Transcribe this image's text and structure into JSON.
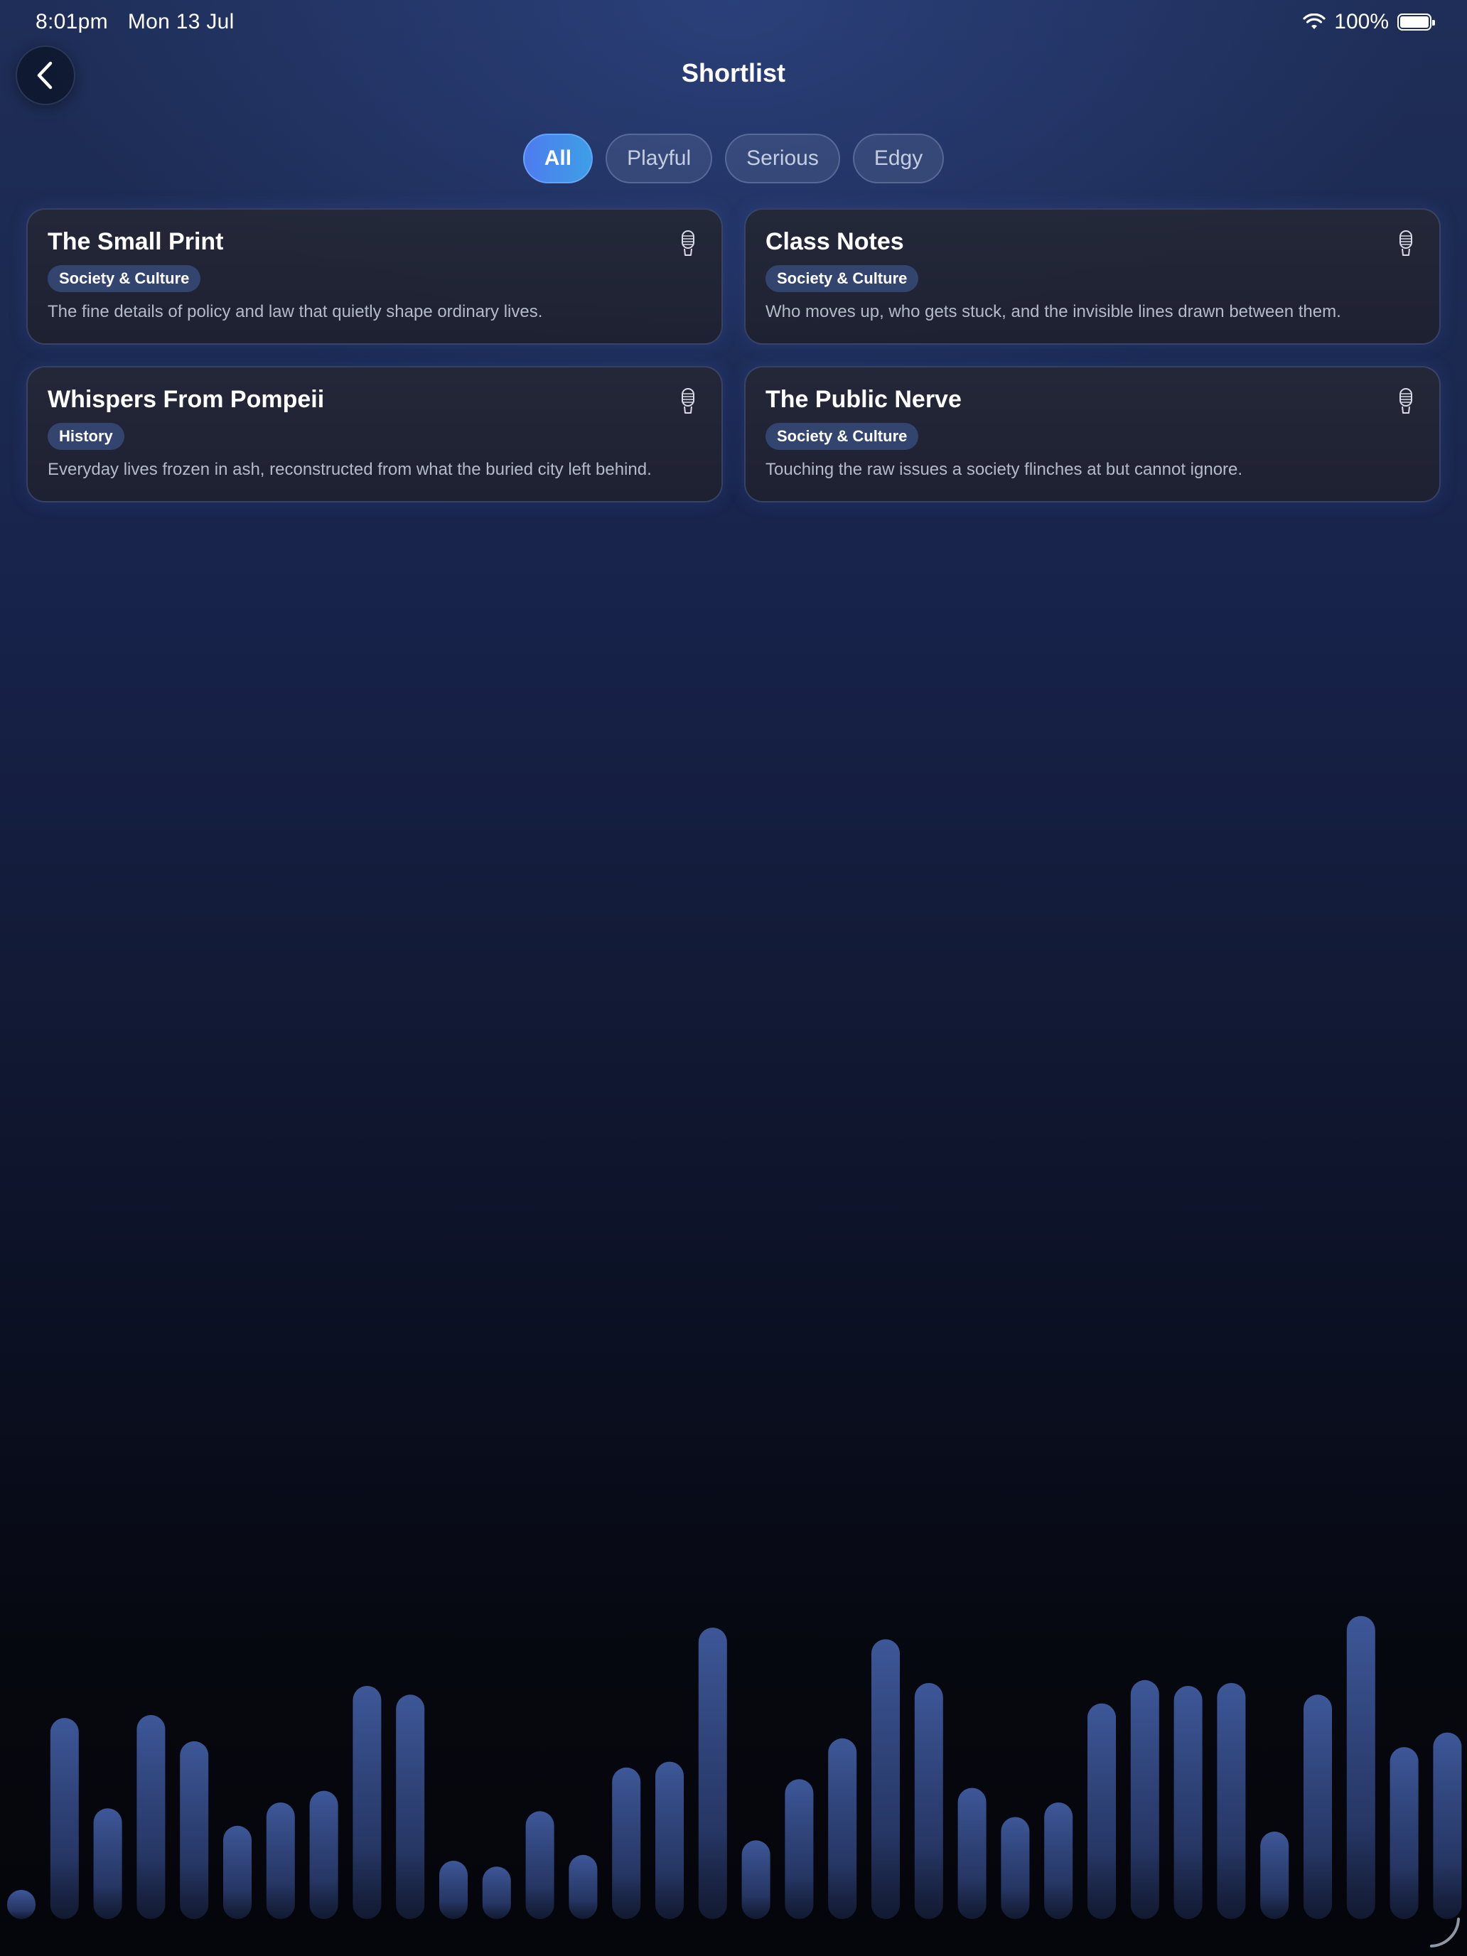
{
  "status_bar": {
    "time": "8:01pm",
    "date": "Mon 13 Jul",
    "battery_text": "100%",
    "battery_level": 1.0
  },
  "header": {
    "title": "Shortlist",
    "back_icon": "chevron-left-icon"
  },
  "filters": [
    {
      "label": "All",
      "active": true
    },
    {
      "label": "Playful",
      "active": false
    },
    {
      "label": "Serious",
      "active": false
    },
    {
      "label": "Edgy",
      "active": false
    }
  ],
  "cards": [
    {
      "title": "The Small Print",
      "tag": "Society & Culture",
      "description": "The fine details of policy and law that quietly shape ordinary lives.",
      "icon": "microphone-icon"
    },
    {
      "title": "Class Notes",
      "tag": "Society & Culture",
      "description": "Who moves up, who gets stuck, and the invisible lines drawn between them.",
      "icon": "microphone-icon"
    },
    {
      "title": "Whispers From Pompeii",
      "tag": "History",
      "description": "Everyday lives frozen in ash, reconstructed from what the buried city left behind.",
      "icon": "microphone-icon"
    },
    {
      "title": "The Public Nerve",
      "tag": "Society & Culture",
      "description": "Touching the raw issues a society flinches at but cannot ignore.",
      "icon": "microphone-icon"
    }
  ],
  "visualizer": {
    "color": "#3a5495",
    "levels": [
      0.1,
      0.69,
      0.38,
      0.7,
      0.61,
      0.32,
      0.4,
      0.44,
      0.8,
      0.77,
      0.2,
      0.18,
      0.37,
      0.22,
      0.52,
      0.54,
      1.0,
      0.27,
      0.48,
      0.62,
      0.96,
      0.81,
      0.45,
      0.35,
      0.4,
      0.74,
      0.82,
      0.8,
      0.81,
      0.3,
      0.77,
      1.04,
      0.59,
      0.64
    ]
  },
  "colors": {
    "accent": "#4e7bef",
    "tag_bg": "#33456f",
    "card_border": "#5569a0"
  }
}
